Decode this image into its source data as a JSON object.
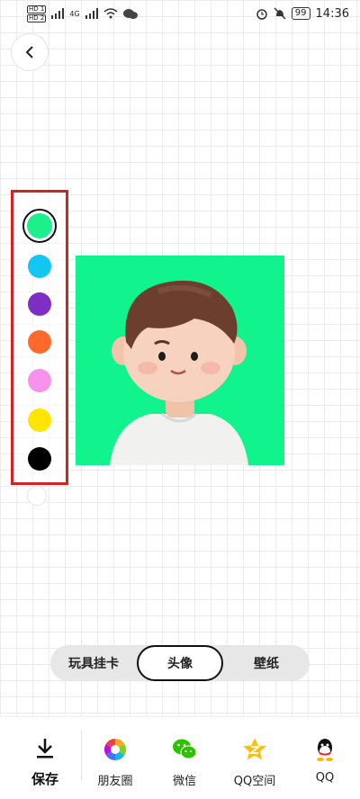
{
  "status_bar": {
    "sim1": "HD 1",
    "sim2": "HD 2",
    "network": "4G",
    "battery": "99",
    "time": "14:36"
  },
  "colors": {
    "swatches": [
      "#1bf08b",
      "#14c6f2",
      "#7e2ec2",
      "#ff6a2c",
      "#f792ec",
      "#ffe600",
      "#000000"
    ],
    "selected_index": 0,
    "panel_border": "#d22424",
    "avatar_background": "#10f38d"
  },
  "mode_tabs": [
    {
      "label": "玩具挂卡"
    },
    {
      "label": "头像"
    },
    {
      "label": "壁纸"
    }
  ],
  "active_tab_index": 1,
  "bottom_bar": {
    "save_label": "保存",
    "share_targets": [
      {
        "label": "朋友圈",
        "icon": "moments-icon"
      },
      {
        "label": "微信",
        "icon": "wechat-icon"
      },
      {
        "label": "QQ空间",
        "icon": "qzone-icon"
      },
      {
        "label": "QQ",
        "icon": "qq-icon"
      }
    ]
  }
}
